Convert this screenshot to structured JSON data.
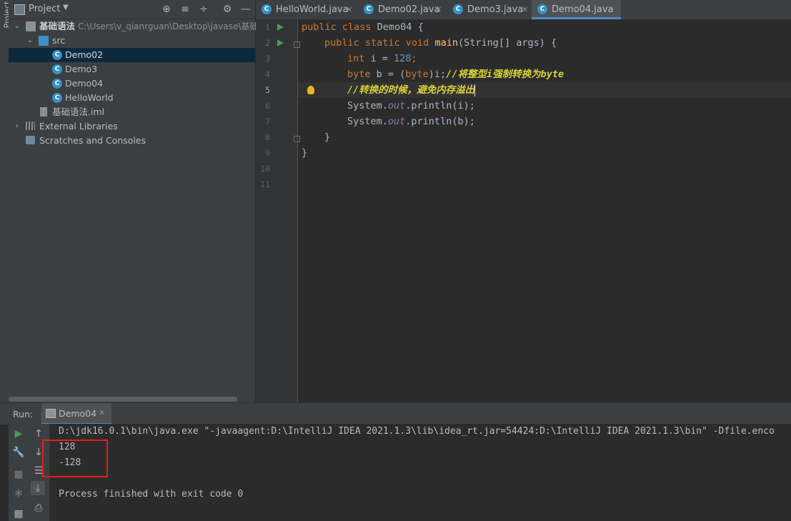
{
  "sidebar_strip": {
    "label": "Project"
  },
  "project": {
    "title": "Project",
    "tree": [
      {
        "label": "基础语法",
        "path": "C:\\Users\\v_qianrguan\\Desktop\\javase\\基础"
      },
      {
        "label": "src"
      },
      {
        "label": "Demo02"
      },
      {
        "label": "Demo3"
      },
      {
        "label": "Demo04"
      },
      {
        "label": "HelloWorld"
      },
      {
        "label": "基础语法.iml"
      },
      {
        "label": "External Libraries"
      },
      {
        "label": "Scratches and Consoles"
      }
    ]
  },
  "tabs": [
    {
      "label": "HelloWorld.java"
    },
    {
      "label": "Demo02.java"
    },
    {
      "label": "Demo3.java"
    },
    {
      "label": "Demo04.java"
    }
  ],
  "editor": {
    "line_numbers": [
      "1",
      "2",
      "3",
      "4",
      "5",
      "6",
      "7",
      "8",
      "9",
      "10",
      "11"
    ],
    "current_line": "5",
    "code": {
      "l1_kw": "public class ",
      "l1_name": "Demo04 {",
      "l2_kw": "public static void ",
      "l2_fn": "main",
      "l2_rest": "(String[] args) {",
      "l3_kw": "int ",
      "l3_a": "i = ",
      "l3_num": "128",
      "l3_b": ";",
      "l4_kw": "byte ",
      "l4_a": "b = (",
      "l4_kw2": "byte",
      "l4_b": ")i;",
      "l4_cm": "//将整型i强制转换为byte",
      "l5_cm": "//转换的时候，避免内存溢出",
      "l6_a": "System.",
      "l6_it": "out",
      "l6_b": ".println(i);",
      "l7_a": "System.",
      "l7_it": "out",
      "l7_b": ".println(b);",
      "l8": "}",
      "l9": "}"
    }
  },
  "run_panel": {
    "label": "Run:",
    "tab": "Demo04",
    "output": [
      "D:\\jdk16.0.1\\bin\\java.exe \"-javaagent:D:\\IntelliJ IDEA 2021.1.3\\lib\\idea_rt.jar=54424:D:\\IntelliJ IDEA 2021.1.3\\bin\" -Dfile.enco",
      "128",
      "-128",
      "",
      "Process finished with exit code 0"
    ]
  }
}
